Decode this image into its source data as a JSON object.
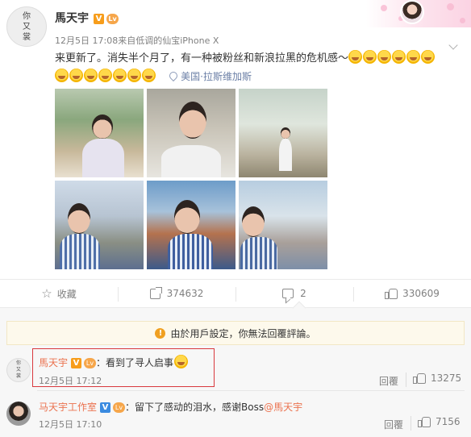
{
  "post": {
    "author": "馬天宇",
    "avatar_text": [
      "你",
      "又",
      "裳"
    ],
    "verified_badge": "V",
    "level_badge": "Lv",
    "date": "12月5日 17:08",
    "source": "来自低调的仙宝iPhone X",
    "text": "来更新了。消失半个月了，有一种被粉丝和新浪拉黑的危机感～",
    "location": "美国·拉斯维加斯",
    "location_icon": "pin-icon",
    "emoji_count_line1": 5,
    "emoji_count_line2": 7
  },
  "photos": [
    {
      "name": "photo-1"
    },
    {
      "name": "photo-2"
    },
    {
      "name": "photo-3"
    },
    {
      "name": "photo-4"
    },
    {
      "name": "photo-5"
    },
    {
      "name": "photo-6"
    }
  ],
  "actions": {
    "favorite_label": "收藏",
    "share_count": "374632",
    "comment_count": "2",
    "like_count": "330609"
  },
  "comments": {
    "notice": "由於用戶設定，你無法回覆評論。",
    "items": [
      {
        "author": "馬天宇",
        "text": "：看到了寻人启事",
        "time": "12月5日 17:12",
        "reply_label": "回覆",
        "likes": "13275"
      },
      {
        "author": "马天宇工作室",
        "text": "：留下了感动的泪水，感谢Boss",
        "mention": "@馬天宇",
        "time": "12月5日 17:10",
        "reply_label": "回覆",
        "likes": "7156"
      }
    ]
  },
  "colors": {
    "name_orange": "#eb7350",
    "highlight_red": "#d9393e",
    "verified_orange": "#f79d1b",
    "verified_blue": "#3b8be0"
  }
}
